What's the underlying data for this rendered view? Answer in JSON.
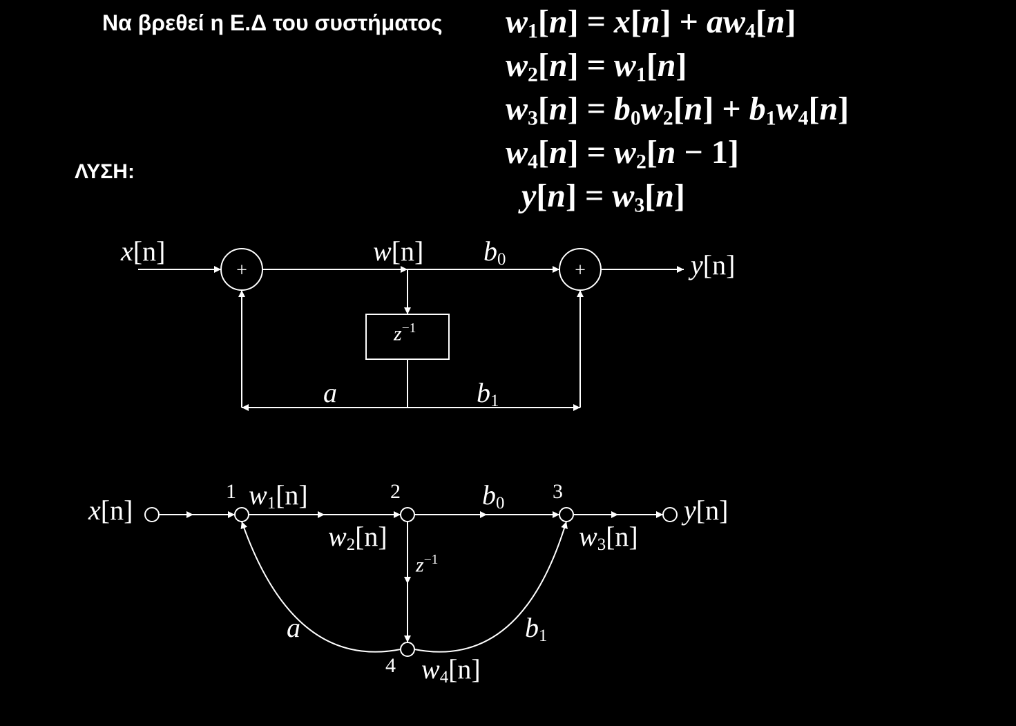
{
  "prompt": "Να βρεθεί η Ε.Δ του συστήματος",
  "solution_label": "ΛΥΣΗ:",
  "equations": {
    "eq1": "w₁[n] = x[n] + aw₄[n]",
    "eq2": "w₂[n] = w₁[n]",
    "eq3": "w₃[n] = b₀w₂[n] + b₁w₄[n]",
    "eq4": "w₄[n] = w₂[n − 1]",
    "eq5": "y[n] = w₃[n]"
  },
  "block_diagram": {
    "input_label": "x[n]",
    "sum1_label": "+",
    "mid_label": "w[n]",
    "gain_b0": "b₀",
    "sum2_label": "+",
    "output_label": "y[n]",
    "delay_label": "z⁻¹",
    "gain_a": "a",
    "gain_b1": "b₁"
  },
  "sfg": {
    "input_label": "x[n]",
    "output_label": "y[n]",
    "node1_num": "1",
    "node2_num": "2",
    "node3_num": "3",
    "node4_num": "4",
    "w1": "w₁[n]",
    "w2": "w₂[n]",
    "w3": "w₃[n]",
    "w4": "w₄[n]",
    "gain_b0": "b₀",
    "gain_a": "a",
    "gain_b1": "b₁",
    "delay_label": "z⁻¹"
  }
}
